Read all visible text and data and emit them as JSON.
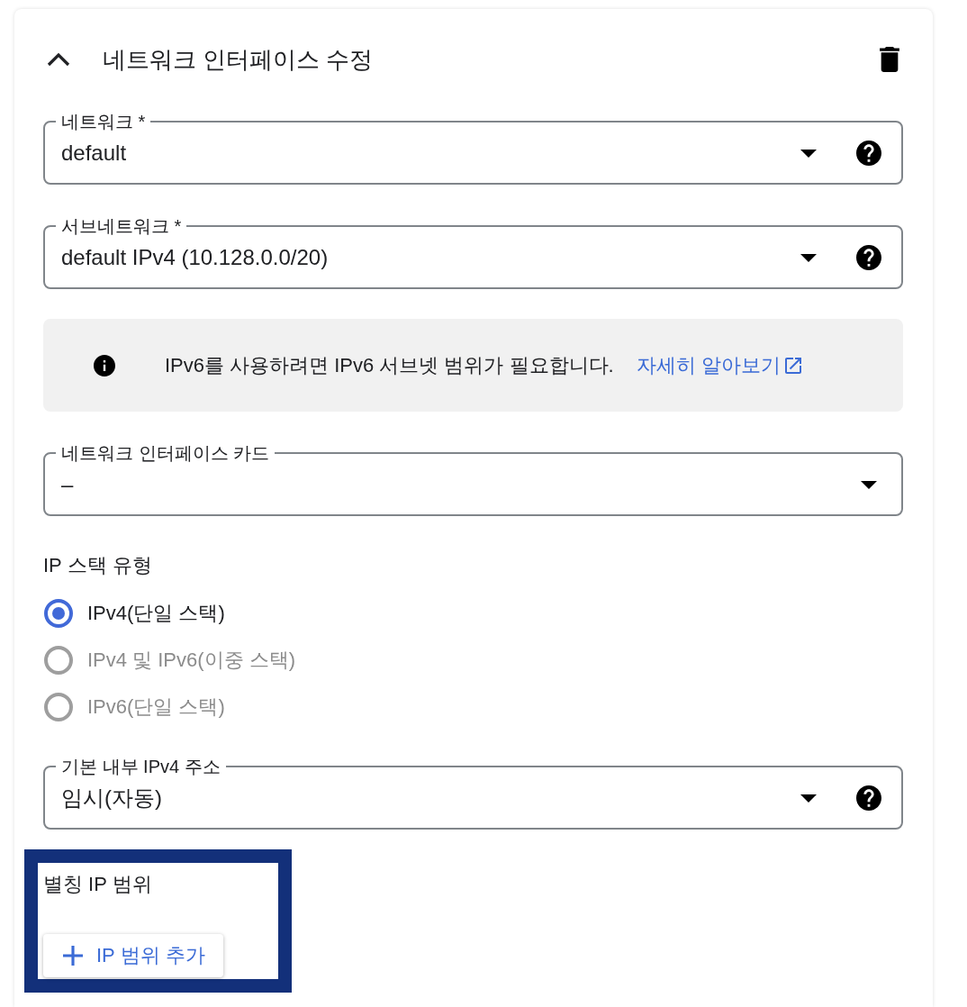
{
  "panel": {
    "title": "네트워크 인터페이스 수정",
    "expanded": true
  },
  "form": [
    {
      "kind": "select",
      "label": "네트워크 *",
      "value": "default",
      "help": true
    },
    {
      "kind": "select",
      "label": "서브네트워크 *",
      "value": "default IPv4 (10.128.0.0/20)",
      "help": true
    },
    {
      "kind": "notice",
      "text": "IPv6를 사용하려면 IPv6 서브넷 범위가 필요합니다.",
      "link": "자세히 알아보기"
    },
    {
      "kind": "select",
      "label": "네트워크 인터페이스 카드",
      "value": "–",
      "help": false
    },
    {
      "kind": "radio_group",
      "title": "IP 스택 유형",
      "options": [
        {
          "label": "IPv4(단일 스택)",
          "selected": true,
          "disabled": false
        },
        {
          "label": "IPv4 및 IPv6(이중 스택)",
          "selected": false,
          "disabled": true
        },
        {
          "label": "IPv6(단일 스택)",
          "selected": false,
          "disabled": true
        }
      ]
    },
    {
      "kind": "select",
      "label": "기본 내부 IPv4 주소",
      "value": "임시(자동)",
      "help": true
    },
    {
      "kind": "alias_ranges",
      "title": "별칭 IP 범위",
      "highlighted": true,
      "button": "IP 범위 추가"
    }
  ]
}
